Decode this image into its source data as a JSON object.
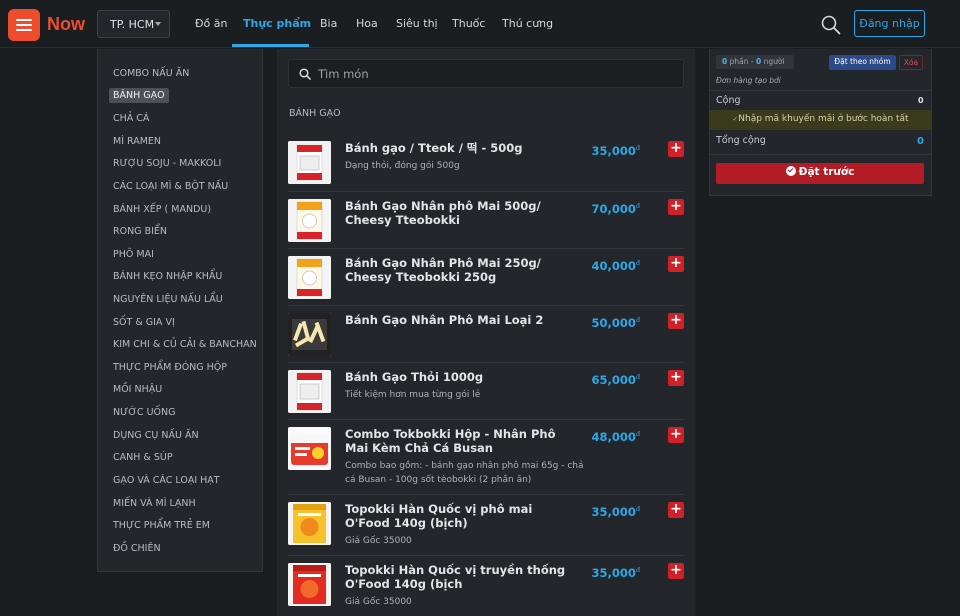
{
  "brand": {
    "name": "Now"
  },
  "city": {
    "label": "TP. HCM"
  },
  "nav": [
    "Đồ ăn",
    "Thực phẩm",
    "Bia",
    "Hoa",
    "Siêu thị",
    "Thuốc",
    "Thú cưng"
  ],
  "nav_active": "Thực phẩm",
  "header": {
    "login_label": "Đăng nhập"
  },
  "categories": [
    "COMBO NẤU ĂN",
    "BÁNH GẠO",
    "CHẢ CÁ",
    "MÌ RAMEN",
    "RƯỢU SOJU - MAKKOLI",
    "CÁC LOẠI MÌ & BỘT NẤU",
    "BÁNH XẾP ( MANDU)",
    "RONG BIỂN",
    "PHÔ MAI",
    "BÁNH KẸO NHẬP KHẨU",
    "NGUYÊN LIỆU NẤU LẨU",
    "SỐT & GIA VỊ",
    "KIM CHI & CỦ CẢI & BANCHAN",
    "THỰC PHẨM ĐÓNG HỘP",
    "MỒI NHẬU",
    "NƯỚC UỐNG",
    "DỤNG CỤ NẤU ĂN",
    "CANH & SÚP",
    "GẠO VÀ CÁC LOẠI HẠT",
    "MIẾN VÀ MÌ LẠNH",
    "THỰC PHẨM TRẺ EM",
    "ĐỒ CHIÊN"
  ],
  "active_category": "BÁNH GẠO",
  "search": {
    "placeholder": "Tìm món"
  },
  "section_title": "BÁNH GẠO",
  "items": [
    {
      "name": "Bánh gạo / Tteok / 떡 - 500g",
      "desc": "Dạng thỏi, đóng gói 500g",
      "price": "35,000",
      "currency": "đ",
      "thumb": "pack-white"
    },
    {
      "name": "Bánh Gạo Nhân phô Mai 500g/ Cheesy Tteobokki",
      "desc": "",
      "price": "70,000",
      "currency": "đ",
      "thumb": "pack-cheese"
    },
    {
      "name": "Bánh Gạo Nhân Phô Mai 250g/ Cheesy Tteobokki 250g",
      "desc": "",
      "price": "40,000",
      "currency": "đ",
      "thumb": "pack-cheese"
    },
    {
      "name": "Bánh Gạo Nhân Phô Mai Loại 2",
      "desc": "",
      "price": "50,000",
      "currency": "đ",
      "thumb": "pack-dark"
    },
    {
      "name": "Bánh Gạo Thỏi 1000g",
      "desc": "Tiết kiệm hơn mua từng gói lẻ",
      "price": "65,000",
      "currency": "đ",
      "thumb": "pack-white"
    },
    {
      "name": "Combo Tokbokki Hộp - Nhân Phô Mai Kèm Chả Cá Busan",
      "desc": "Combo bao gồm: - bánh gạo nhân phô mai 65g - chả cá Busan - 100g sốt tèobokki (2 phần ăn)",
      "price": "48,000",
      "currency": "đ",
      "thumb": "cup-red"
    },
    {
      "name": "Topokki Hàn Quốc vị phô mai O'Food 140g (bịch)",
      "desc": "Giá Gốc 35000",
      "price": "35,000",
      "currency": "đ",
      "thumb": "bag-yellow"
    },
    {
      "name": "Topokki Hàn Quốc vị truyền thống O'Food 140g (bịch",
      "desc": "Giá Gốc 35000",
      "price": "35,000",
      "currency": "đ",
      "thumb": "bag-red"
    }
  ],
  "cart": {
    "count_num": "0",
    "count_portion": "phần",
    "count_sep": "-",
    "count_people": "0",
    "count_person": "người",
    "group_btn": "Đặt theo nhóm",
    "delete_btn": "Xóa",
    "created_by": "Đơn hàng tạo bởi",
    "subtotal_label": "Cộng",
    "subtotal_value": "0",
    "promo": "Nhập mã khuyến mãi ở bước hoàn tất",
    "total_label": "Tổng cộng",
    "total_value": "0",
    "order_btn": "Đặt trước"
  },
  "colors": {
    "brand": "#ee4d2d",
    "accent": "#2fa6e6",
    "danger": "#cf2127",
    "bg": "#1b1e21",
    "panel": "#23272b"
  }
}
